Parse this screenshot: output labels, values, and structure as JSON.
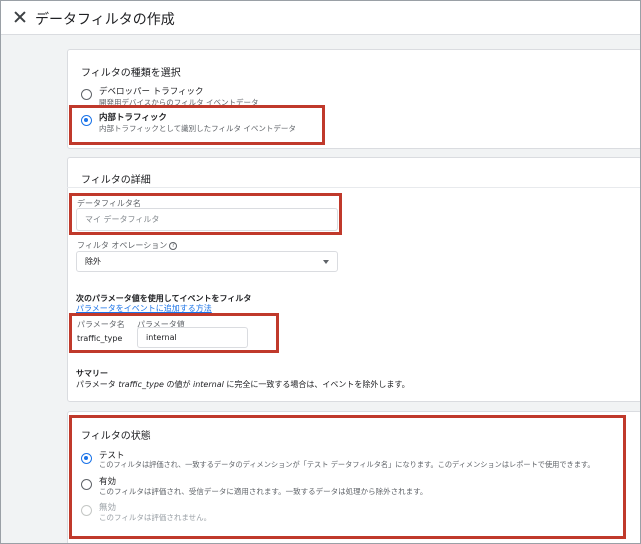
{
  "header": {
    "title": "データフィルタの作成"
  },
  "filter_type": {
    "title": "フィルタの種類を選択",
    "options": [
      {
        "label": "デベロッパー トラフィック",
        "desc": "開発用デバイスからのフィルタ イベントデータ",
        "selected": false
      },
      {
        "label": "内部トラフィック",
        "desc": "内部トラフィックとして識別したフィルタ イベントデータ",
        "selected": true
      }
    ]
  },
  "details": {
    "title": "フィルタの詳細",
    "name_label": "データフィルタ名",
    "name_placeholder": "マイ データフィルタ",
    "operation_label": "フィルタ オペレーション",
    "operation_help": "?",
    "operation_value": "除外",
    "param_heading": "次のパラメータ値を使用してイベントをフィルタ",
    "param_link": "パラメータをイベントに追加する方法",
    "param_name_label": "パラメータ名",
    "param_value_label": "パラメータ値",
    "param_name": "traffic_type",
    "param_value": "internal",
    "summary_title": "サマリー",
    "summary_prefix": "パラメータ ",
    "summary_param": "traffic_type",
    "summary_mid": " の値が ",
    "summary_value": "internal",
    "summary_suffix": " に完全に一致する場合は、イベントを除外します。"
  },
  "status": {
    "title": "フィルタの状態",
    "options": [
      {
        "label": "テスト",
        "desc": "このフィルタは評価され、一致するデータのディメンションが「テスト データフィルタ名」になります。このディメンションはレポートで使用できます。",
        "selected": true,
        "disabled": false
      },
      {
        "label": "有効",
        "desc": "このフィルタは評価され、受信データに適用されます。一致するデータは処理から除外されます。",
        "selected": false,
        "disabled": false
      },
      {
        "label": "無効",
        "desc": "このフィルタは評価されません。",
        "selected": false,
        "disabled": true
      }
    ]
  },
  "colors": {
    "accent": "#1a73e8",
    "highlight": "#c0392b"
  }
}
